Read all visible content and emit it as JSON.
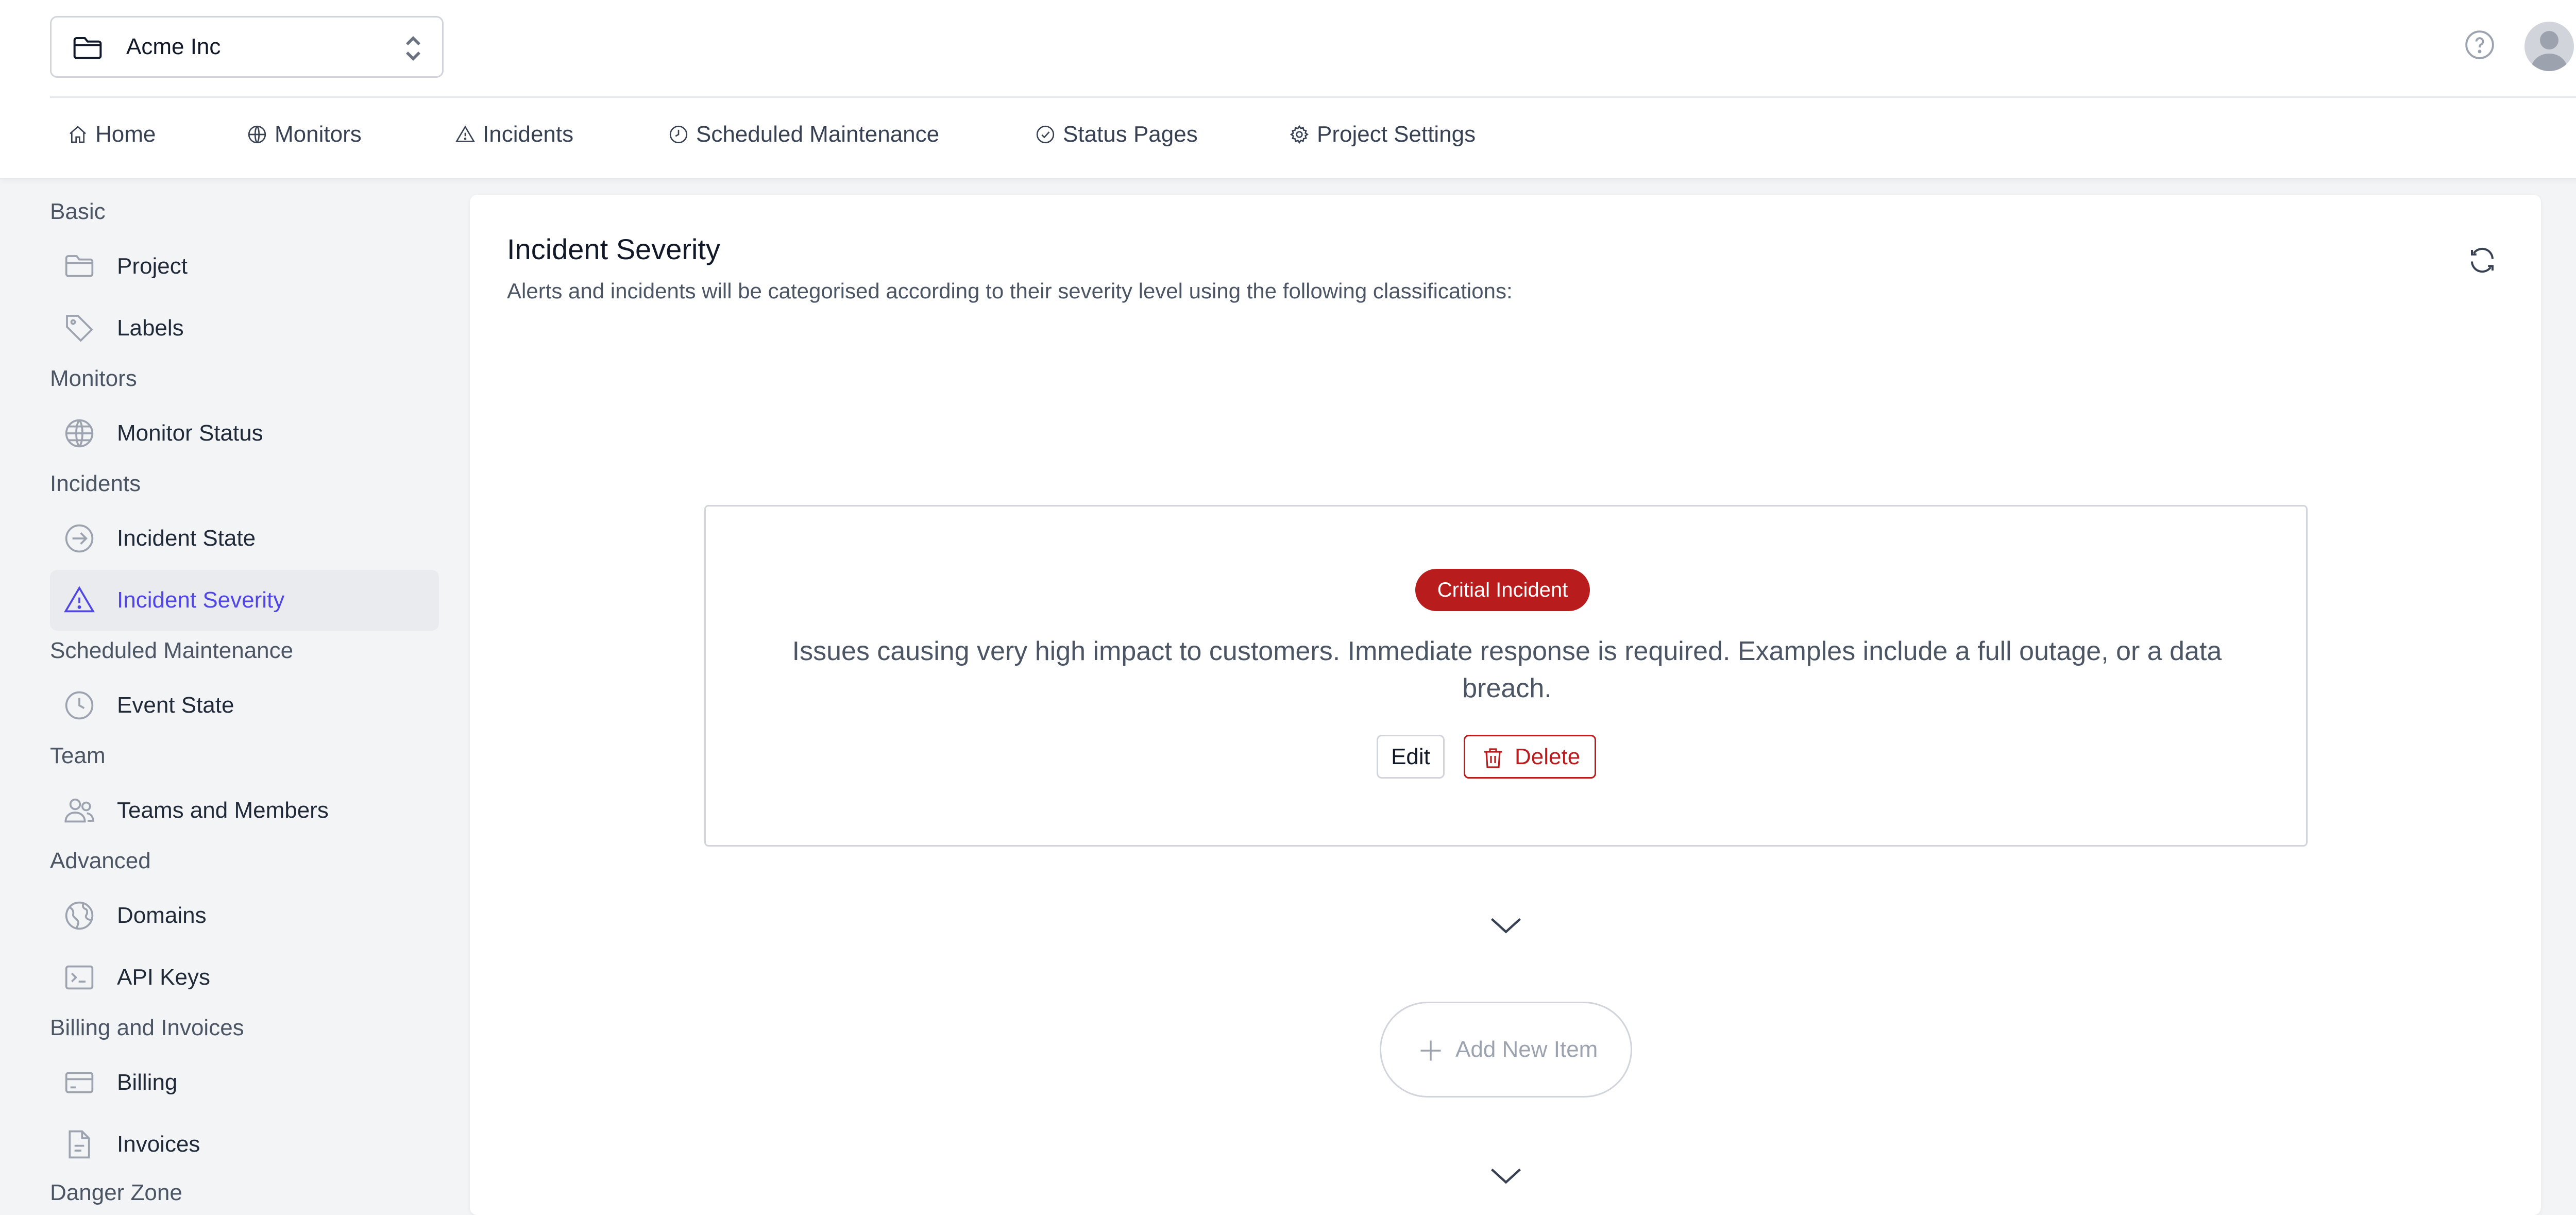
{
  "header": {
    "project_name": "Acme Inc",
    "nav": [
      {
        "label": "Home",
        "icon": "home-icon"
      },
      {
        "label": "Monitors",
        "icon": "globe-icon"
      },
      {
        "label": "Incidents",
        "icon": "alert-triangle-icon"
      },
      {
        "label": "Scheduled Maintenance",
        "icon": "clock-icon"
      },
      {
        "label": "Status Pages",
        "icon": "check-circle-icon"
      },
      {
        "label": "Project Settings",
        "icon": "gear-icon"
      }
    ]
  },
  "sidebar": {
    "sections": [
      {
        "title": "Basic",
        "items": [
          {
            "label": "Project",
            "icon": "folder-icon"
          },
          {
            "label": "Labels",
            "icon": "tag-icon"
          }
        ]
      },
      {
        "title": "Monitors",
        "items": [
          {
            "label": "Monitor Status",
            "icon": "globe-icon"
          }
        ]
      },
      {
        "title": "Incidents",
        "items": [
          {
            "label": "Incident State",
            "icon": "arrow-circle-icon"
          },
          {
            "label": "Incident Severity",
            "icon": "alert-triangle-icon",
            "active": true
          }
        ]
      },
      {
        "title": "Scheduled Maintenance",
        "items": [
          {
            "label": "Event State",
            "icon": "clock-icon"
          }
        ]
      },
      {
        "title": "Team",
        "items": [
          {
            "label": "Teams and Members",
            "icon": "users-icon"
          }
        ]
      },
      {
        "title": "Advanced",
        "items": [
          {
            "label": "Domains",
            "icon": "globe-alt-icon"
          },
          {
            "label": "API Keys",
            "icon": "terminal-icon"
          }
        ]
      },
      {
        "title": "Billing and Invoices",
        "items": [
          {
            "label": "Billing",
            "icon": "credit-card-icon"
          },
          {
            "label": "Invoices",
            "icon": "document-icon"
          }
        ]
      },
      {
        "title": "Danger Zone",
        "items": []
      }
    ]
  },
  "main": {
    "title": "Incident Severity",
    "description": "Alerts and incidents will be categorised according to their severity level using the following classifications:",
    "item": {
      "badge": "Critial Incident",
      "badge_color": "#b91c1c",
      "description": "Issues causing very high impact to customers. Immediate response is required. Examples include a full outage, or a data breach.",
      "edit_label": "Edit",
      "delete_label": "Delete"
    },
    "add_label": "Add New Item"
  },
  "colors": {
    "accent": "#4f46e5",
    "danger": "#b91c1c"
  }
}
